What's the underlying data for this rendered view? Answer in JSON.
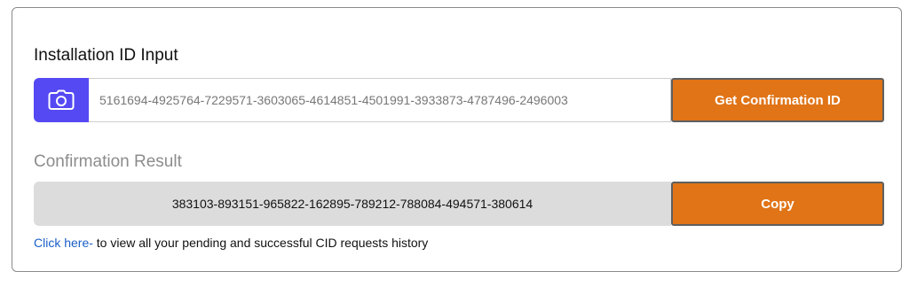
{
  "installation": {
    "title": "Installation ID Input",
    "camera_icon": "camera-icon",
    "input_value": "",
    "input_placeholder": "5161694-4925764-7229571-3603065-4614851-4501991-3933873-4787496-2496003",
    "button_label": "Get Confirmation ID"
  },
  "result": {
    "title": "Confirmation Result",
    "value": "383103-893151-965822-162895-789212-788084-494571-380614",
    "copy_label": "Copy"
  },
  "footer": {
    "link_text": "Click here-",
    "text": " to view all your pending and successful CID requests history"
  },
  "colors": {
    "accent_purple": "#5549f3",
    "button_orange": "#e07417",
    "link_blue": "#1a5fc8",
    "result_bg": "#dcdcdc"
  }
}
